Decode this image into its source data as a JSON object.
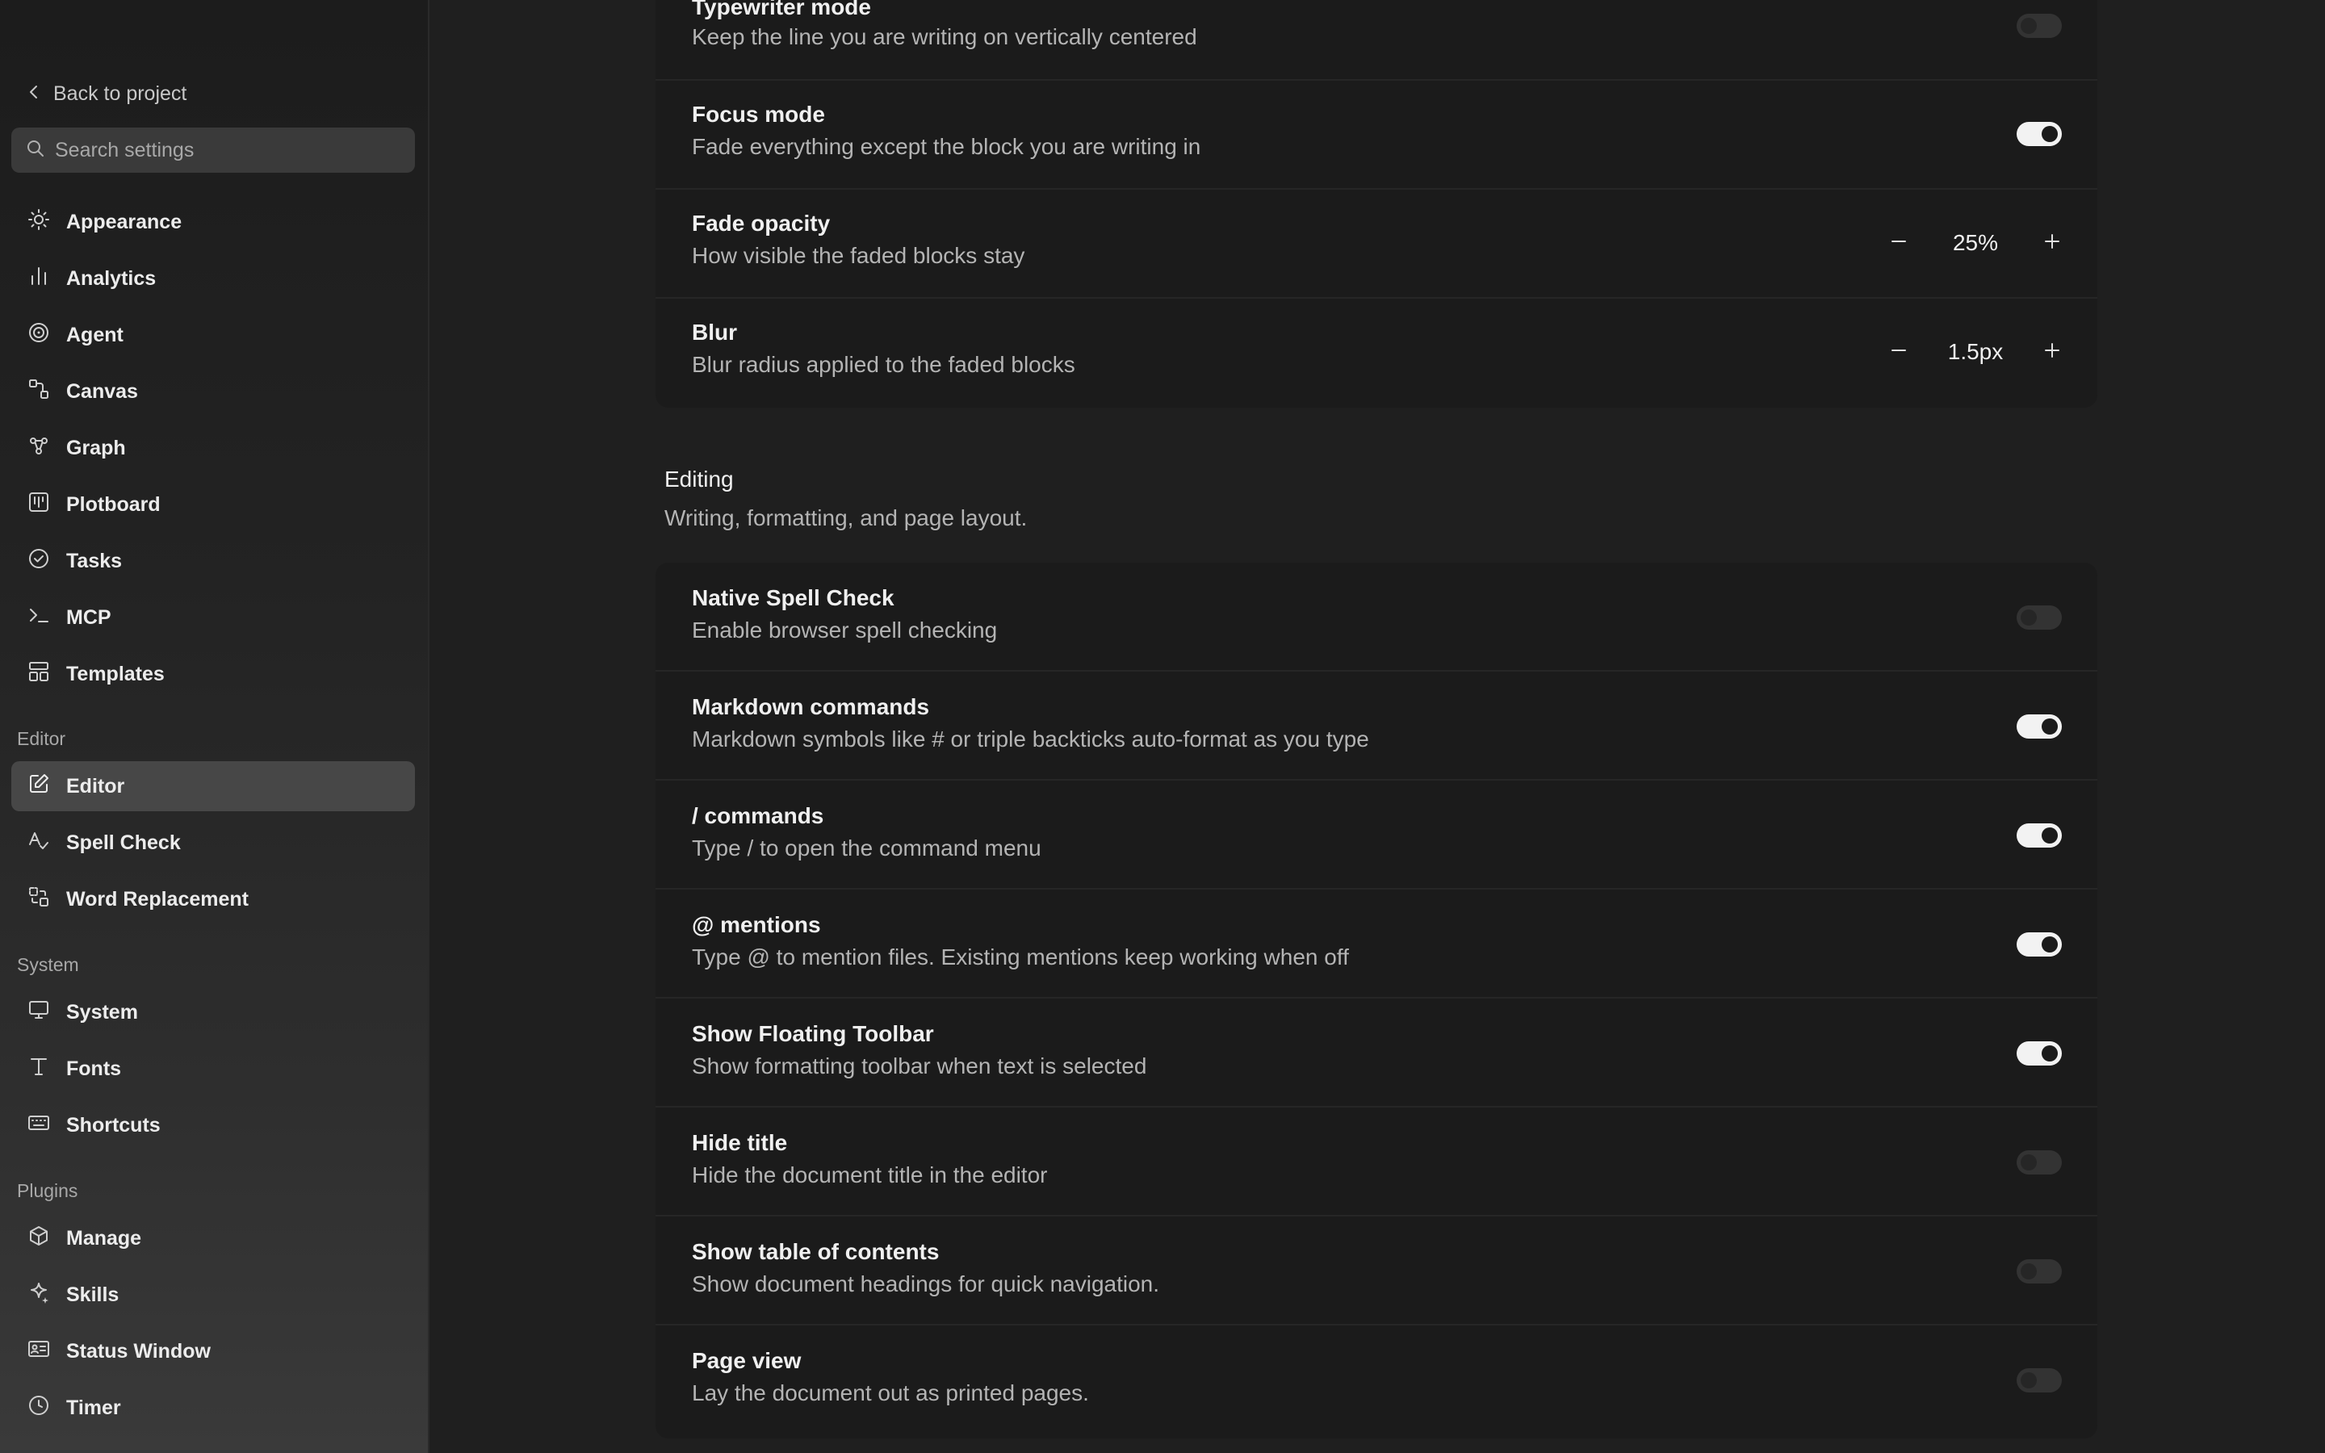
{
  "sidebar": {
    "back_label": "Back to project",
    "search_placeholder": "Search settings",
    "items_general": [
      {
        "label": "Appearance",
        "icon": "sun-icon"
      },
      {
        "label": "Analytics",
        "icon": "bar-chart-icon"
      },
      {
        "label": "Agent",
        "icon": "spiral-icon"
      },
      {
        "label": "Canvas",
        "icon": "canvas-icon"
      },
      {
        "label": "Graph",
        "icon": "graph-icon"
      },
      {
        "label": "Plotboard",
        "icon": "plotboard-icon"
      },
      {
        "label": "Tasks",
        "icon": "check-circle-icon"
      },
      {
        "label": "MCP",
        "icon": "terminal-icon"
      },
      {
        "label": "Templates",
        "icon": "templates-icon"
      }
    ],
    "section_editor": "Editor",
    "items_editor": [
      {
        "label": "Editor",
        "icon": "edit-icon",
        "active": true
      },
      {
        "label": "Spell Check",
        "icon": "spell-check-icon"
      },
      {
        "label": "Word Replacement",
        "icon": "replace-icon"
      }
    ],
    "section_system": "System",
    "items_system": [
      {
        "label": "System",
        "icon": "monitor-icon"
      },
      {
        "label": "Fonts",
        "icon": "type-icon"
      },
      {
        "label": "Shortcuts",
        "icon": "keyboard-icon"
      }
    ],
    "section_plugins": "Plugins",
    "items_plugins": [
      {
        "label": "Manage",
        "icon": "package-icon"
      },
      {
        "label": "Skills",
        "icon": "sparkle-icon"
      },
      {
        "label": "Status Window",
        "icon": "id-card-icon"
      },
      {
        "label": "Timer",
        "icon": "clock-icon"
      }
    ]
  },
  "focus_section": {
    "rows": [
      {
        "title": "Typewriter mode",
        "desc": "Keep the line you are writing on vertically centered",
        "toggle": false
      },
      {
        "title": "Focus mode",
        "desc": "Fade everything except the block you are writing in",
        "toggle": true
      },
      {
        "title": "Fade opacity",
        "desc": "How visible the faded blocks stay",
        "value": "25%"
      },
      {
        "title": "Blur",
        "desc": "Blur radius applied to the faded blocks",
        "value": "1.5px"
      }
    ]
  },
  "editing_section": {
    "title": "Editing",
    "desc": "Writing, formatting, and page layout.",
    "rows": [
      {
        "title": "Native Spell Check",
        "desc": "Enable browser spell checking",
        "toggle": false
      },
      {
        "title": "Markdown commands",
        "desc": "Markdown symbols like # or triple backticks auto-format as you type",
        "toggle": true
      },
      {
        "title": "/ commands",
        "desc": "Type / to open the command menu",
        "toggle": true
      },
      {
        "title": "@ mentions",
        "desc": "Type @ to mention files. Existing mentions keep working when off",
        "toggle": true
      },
      {
        "title": "Show Floating Toolbar",
        "desc": "Show formatting toolbar when text is selected",
        "toggle": true
      },
      {
        "title": "Hide title",
        "desc": "Hide the document title in the editor",
        "toggle": false
      },
      {
        "title": "Show table of contents",
        "desc": "Show document headings for quick navigation.",
        "toggle": false
      },
      {
        "title": "Page view",
        "desc": "Lay the document out as printed pages.",
        "toggle": false
      }
    ]
  }
}
